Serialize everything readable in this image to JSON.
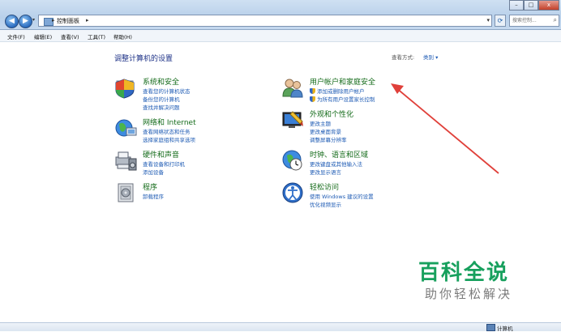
{
  "window": {
    "breadcrumb": "控制面板",
    "search_placeholder": "搜索控制...",
    "minimize": "–",
    "maximize": "□",
    "close": "x"
  },
  "menu": [
    "文件(F)",
    "编辑(E)",
    "查看(V)",
    "工具(T)",
    "帮助(H)"
  ],
  "page": {
    "title": "调整计算机的设置",
    "view_by_label": "查看方式:",
    "view_by_value": "类别 ▾"
  },
  "categories_left": [
    {
      "title": "系统和安全",
      "icon": "system-security-icon",
      "links": [
        "查看您的计算机状态",
        "备份您的计算机",
        "查找并解决问题"
      ]
    },
    {
      "title": "网络和 Internet",
      "icon": "network-icon",
      "links": [
        "查看网络状态和任务",
        "选择家庭组和共享选项"
      ]
    },
    {
      "title": "硬件和声音",
      "icon": "hardware-sound-icon",
      "links": [
        "查看设备和打印机",
        "添加设备"
      ]
    },
    {
      "title": "程序",
      "icon": "programs-icon",
      "links": [
        "卸载程序"
      ]
    }
  ],
  "categories_right": [
    {
      "title": "用户帐户和家庭安全",
      "icon": "user-accounts-icon",
      "links": [
        "添加或删除用户帐户",
        "为所有用户设置家长控制"
      ]
    },
    {
      "title": "外观和个性化",
      "icon": "appearance-icon",
      "links": [
        "更改主题",
        "更改桌面背景",
        "调整屏幕分辨率"
      ]
    },
    {
      "title": "时钟、语言和区域",
      "icon": "clock-language-icon",
      "links": [
        "更改键盘或其他输入法",
        "更改显示语言"
      ]
    },
    {
      "title": "轻松访问",
      "icon": "ease-of-access-icon",
      "links": [
        "使用 Windows 建议的设置",
        "优化视频显示"
      ]
    }
  ],
  "statusbar": {
    "text": "计算机"
  },
  "watermark": {
    "line1": "百科全说",
    "line2": "助你轻松解决"
  },
  "colors": {
    "category_title": "#146b1a",
    "link": "#1e5bb4",
    "page_title": "#1e3287",
    "arrow": "#e0403a",
    "watermark": "#17a05d"
  }
}
